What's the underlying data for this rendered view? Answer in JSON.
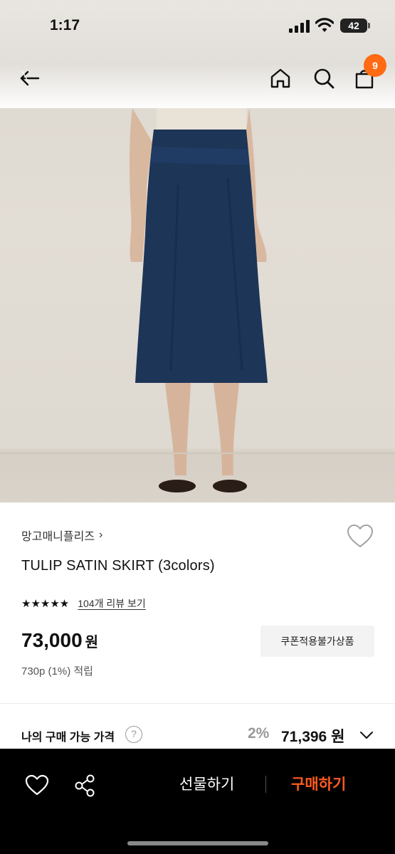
{
  "status_bar": {
    "time": "1:17",
    "battery": "42"
  },
  "nav": {
    "cart_count": "9"
  },
  "product": {
    "brand": "망고매니플리즈",
    "brand_chevron": "›",
    "title": "TULIP SATIN SKIRT (3colors)",
    "stars": "★★★★★",
    "review_link": "104개 리뷰 보기",
    "price": "73,000",
    "price_unit": "원",
    "points": "730p (1%) 적립",
    "coupon_notice": "쿠폰적용불가상품"
  },
  "my_price": {
    "label": "나의 구매 가능 가격",
    "help": "?",
    "discount": "2%",
    "price": "71,396 원"
  },
  "bottom_bar": {
    "gift_label": "선물하기",
    "buy_label": "구매하기"
  },
  "colors": {
    "accent": "#ff6a13",
    "buy": "#ff5a1f",
    "skirt": "#1d3557"
  }
}
